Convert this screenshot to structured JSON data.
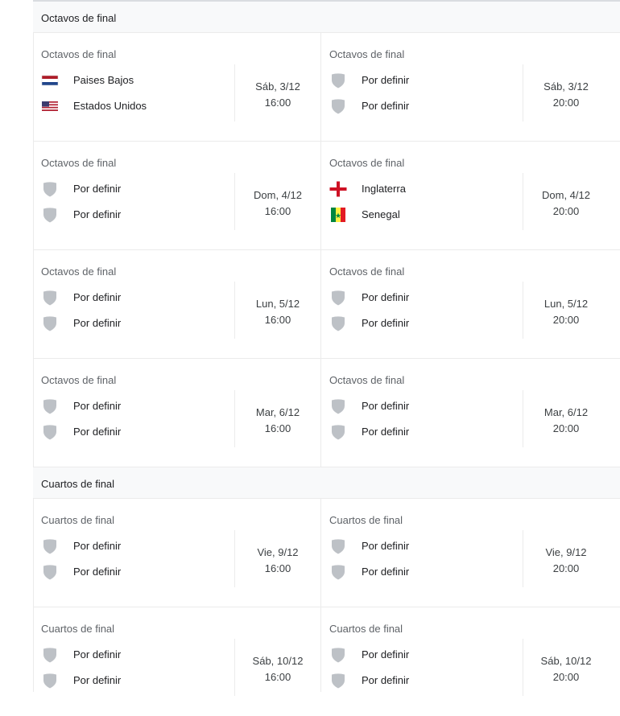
{
  "sections": [
    {
      "title": "Octavos de final",
      "matches": [
        {
          "label": "Octavos de final",
          "teams": [
            {
              "name": "Paises Bajos",
              "icon": "netherlands-flag-icon"
            },
            {
              "name": "Estados Unidos",
              "icon": "usa-flag-icon"
            }
          ],
          "date": "Sáb, 3/12",
          "time": "16:00"
        },
        {
          "label": "Octavos de final",
          "teams": [
            {
              "name": "Por definir",
              "icon": "shield-icon"
            },
            {
              "name": "Por definir",
              "icon": "shield-icon"
            }
          ],
          "date": "Sáb, 3/12",
          "time": "20:00"
        },
        {
          "label": "Octavos de final",
          "teams": [
            {
              "name": "Por definir",
              "icon": "shield-icon"
            },
            {
              "name": "Por definir",
              "icon": "shield-icon"
            }
          ],
          "date": "Dom, 4/12",
          "time": "16:00"
        },
        {
          "label": "Octavos de final",
          "teams": [
            {
              "name": "Inglaterra",
              "icon": "england-flag-icon"
            },
            {
              "name": "Senegal",
              "icon": "senegal-flag-icon"
            }
          ],
          "date": "Dom, 4/12",
          "time": "20:00"
        },
        {
          "label": "Octavos de final",
          "teams": [
            {
              "name": "Por definir",
              "icon": "shield-icon"
            },
            {
              "name": "Por definir",
              "icon": "shield-icon"
            }
          ],
          "date": "Lun, 5/12",
          "time": "16:00"
        },
        {
          "label": "Octavos de final",
          "teams": [
            {
              "name": "Por definir",
              "icon": "shield-icon"
            },
            {
              "name": "Por definir",
              "icon": "shield-icon"
            }
          ],
          "date": "Lun, 5/12",
          "time": "20:00"
        },
        {
          "label": "Octavos de final",
          "teams": [
            {
              "name": "Por definir",
              "icon": "shield-icon"
            },
            {
              "name": "Por definir",
              "icon": "shield-icon"
            }
          ],
          "date": "Mar, 6/12",
          "time": "16:00"
        },
        {
          "label": "Octavos de final",
          "teams": [
            {
              "name": "Por definir",
              "icon": "shield-icon"
            },
            {
              "name": "Por definir",
              "icon": "shield-icon"
            }
          ],
          "date": "Mar, 6/12",
          "time": "20:00"
        }
      ]
    },
    {
      "title": "Cuartos de final",
      "matches": [
        {
          "label": "Cuartos de final",
          "teams": [
            {
              "name": "Por definir",
              "icon": "shield-icon"
            },
            {
              "name": "Por definir",
              "icon": "shield-icon"
            }
          ],
          "date": "Vie, 9/12",
          "time": "16:00"
        },
        {
          "label": "Cuartos de final",
          "teams": [
            {
              "name": "Por definir",
              "icon": "shield-icon"
            },
            {
              "name": "Por definir",
              "icon": "shield-icon"
            }
          ],
          "date": "Vie, 9/12",
          "time": "20:00"
        },
        {
          "label": "Cuartos de final",
          "teams": [
            {
              "name": "Por definir",
              "icon": "shield-icon"
            },
            {
              "name": "Por definir",
              "icon": "shield-icon"
            }
          ],
          "date": "Sáb, 10/12",
          "time": "16:00"
        },
        {
          "label": "Cuartos de final",
          "teams": [
            {
              "name": "Por definir",
              "icon": "shield-icon"
            },
            {
              "name": "Por definir",
              "icon": "shield-icon"
            }
          ],
          "date": "Sáb, 10/12",
          "time": "20:00"
        }
      ]
    }
  ],
  "colors": {
    "shield": "#bdc1c6",
    "divider": "#ebebeb",
    "header_bg": "#f8f9fa",
    "muted_text": "#5f6368"
  }
}
